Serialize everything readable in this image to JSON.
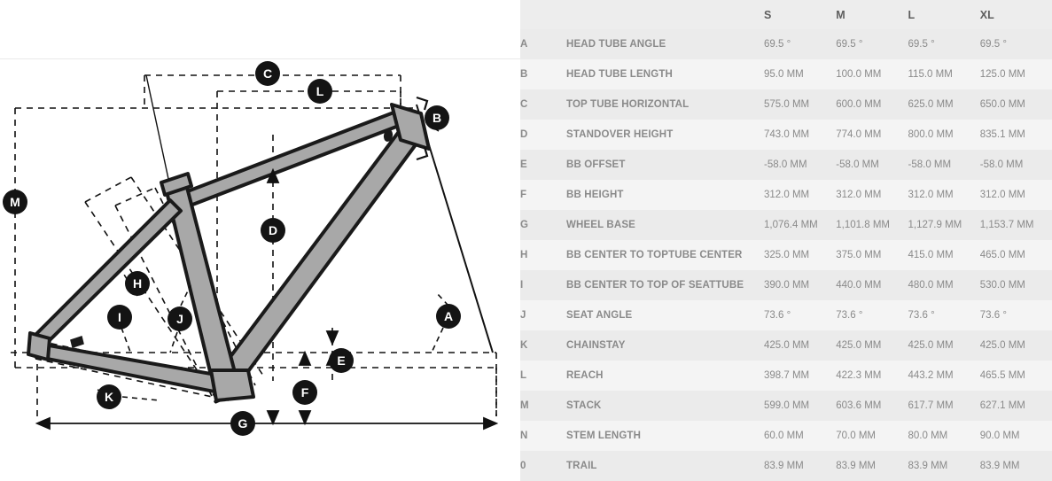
{
  "table": {
    "headers": {
      "letter": "",
      "label": "",
      "sizes": [
        "S",
        "M",
        "L",
        "XL"
      ]
    },
    "rows": [
      {
        "letter": "A",
        "label": "HEAD TUBE ANGLE",
        "values": [
          "69.5 °",
          "69.5 °",
          "69.5 °",
          "69.5 °"
        ]
      },
      {
        "letter": "B",
        "label": "HEAD TUBE LENGTH",
        "values": [
          "95.0 MM",
          "100.0 MM",
          "115.0 MM",
          "125.0 MM"
        ]
      },
      {
        "letter": "C",
        "label": "TOP TUBE HORIZONTAL",
        "values": [
          "575.0 MM",
          "600.0 MM",
          "625.0 MM",
          "650.0 MM"
        ]
      },
      {
        "letter": "D",
        "label": "STANDOVER HEIGHT",
        "values": [
          "743.0 MM",
          "774.0 MM",
          "800.0 MM",
          "835.1 MM"
        ]
      },
      {
        "letter": "E",
        "label": "BB OFFSET",
        "values": [
          "-58.0 MM",
          "-58.0 MM",
          "-58.0 MM",
          "-58.0 MM"
        ]
      },
      {
        "letter": "F",
        "label": "BB HEIGHT",
        "values": [
          "312.0 MM",
          "312.0 MM",
          "312.0 MM",
          "312.0 MM"
        ]
      },
      {
        "letter": "G",
        "label": "WHEEL BASE",
        "values": [
          "1,076.4 MM",
          "1,101.8 MM",
          "1,127.9 MM",
          "1,153.7 MM"
        ]
      },
      {
        "letter": "H",
        "label": "BB CENTER TO TOPTUBE CENTER",
        "values": [
          "325.0 MM",
          "375.0 MM",
          "415.0 MM",
          "465.0 MM"
        ]
      },
      {
        "letter": "I",
        "label": "BB CENTER TO TOP OF SEATTUBE",
        "values": [
          "390.0 MM",
          "440.0 MM",
          "480.0 MM",
          "530.0 MM"
        ]
      },
      {
        "letter": "J",
        "label": "SEAT ANGLE",
        "values": [
          "73.6 °",
          "73.6 °",
          "73.6 °",
          "73.6 °"
        ]
      },
      {
        "letter": "K",
        "label": "CHAINSTAY",
        "values": [
          "425.0 MM",
          "425.0 MM",
          "425.0 MM",
          "425.0 MM"
        ]
      },
      {
        "letter": "L",
        "label": "REACH",
        "values": [
          "398.7 MM",
          "422.3 MM",
          "443.2 MM",
          "465.5 MM"
        ]
      },
      {
        "letter": "M",
        "label": "STACK",
        "values": [
          "599.0 MM",
          "603.6 MM",
          "617.7 MM",
          "627.1 MM"
        ]
      },
      {
        "letter": "N",
        "label": "STEM LENGTH",
        "values": [
          "60.0 MM",
          "70.0 MM",
          "80.0 MM",
          "90.0 MM"
        ]
      },
      {
        "letter": "0",
        "label": "TRAIL",
        "values": [
          "83.9 MM",
          "83.9 MM",
          "83.9 MM",
          "83.9 MM"
        ]
      }
    ]
  },
  "diagram": {
    "markers": [
      {
        "id": "A",
        "label": "A"
      },
      {
        "id": "B",
        "label": "B"
      },
      {
        "id": "C",
        "label": "C"
      },
      {
        "id": "D",
        "label": "D"
      },
      {
        "id": "E",
        "label": "E"
      },
      {
        "id": "F",
        "label": "F"
      },
      {
        "id": "G",
        "label": "G"
      },
      {
        "id": "H",
        "label": "H"
      },
      {
        "id": "I",
        "label": "I"
      },
      {
        "id": "J",
        "label": "J"
      },
      {
        "id": "K",
        "label": "K"
      },
      {
        "id": "L",
        "label": "L"
      },
      {
        "id": "M",
        "label": "M"
      }
    ],
    "colors": {
      "frame_fill": "#a8a8a8",
      "frame_outline": "#1a1a1a",
      "guide_line": "#111111",
      "marker_fill": "#141414",
      "marker_text": "#ffffff",
      "background": "#ffffff"
    }
  }
}
